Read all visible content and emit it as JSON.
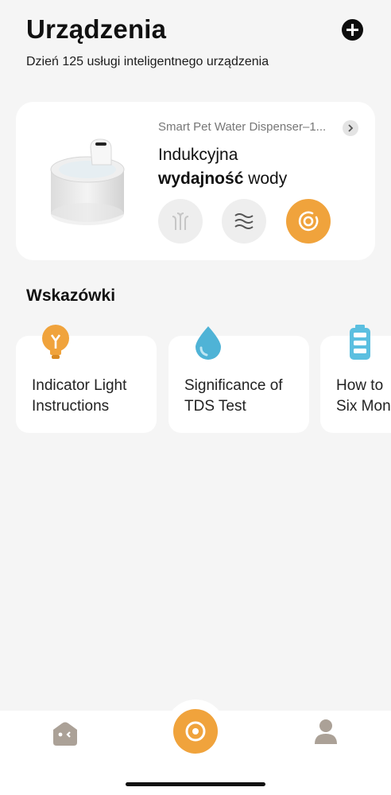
{
  "header": {
    "title": "Urządzenia",
    "subtitle": "Dzień 125 usługi inteligentnego urządzenia",
    "add_icon": "plus-circle-icon"
  },
  "device": {
    "name": "Smart Pet Water Dispenser–1...",
    "mode_line1": "Indukcyjna",
    "mode_line2_bold": "wydajność",
    "mode_line2_rest": " wody",
    "modes": [
      {
        "icon": "fountain-icon",
        "active": false
      },
      {
        "icon": "waves-icon",
        "active": false
      },
      {
        "icon": "induction-icon",
        "active": true
      }
    ],
    "accent_color": "#f0a33c"
  },
  "tips": {
    "title": "Wskazówki",
    "items": [
      {
        "icon": "lightbulb-icon",
        "text": "Indicator Light\nInstructions"
      },
      {
        "icon": "water-drop-icon",
        "text": "Significance of\nTDS Test"
      },
      {
        "icon": "battery-icon",
        "text": "How to\nSix Mon"
      }
    ]
  },
  "tabbar": {
    "items": [
      "home-icon",
      "induction-icon",
      "profile-icon"
    ]
  }
}
